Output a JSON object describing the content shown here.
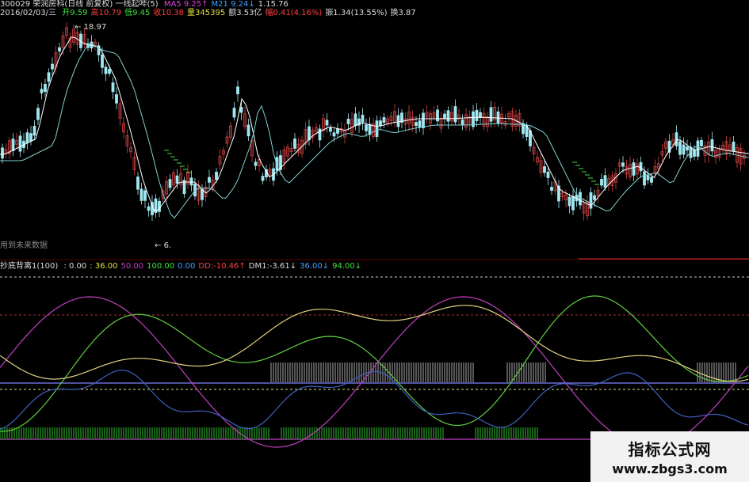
{
  "header": {
    "code_line": "300029 荣润房科(日线 前复权) 一线起哔(5)",
    "ma_items": [
      {
        "text": "MA5 9.25↑",
        "color": "#e040e0"
      },
      {
        "text": "M21 9.24↓",
        "color": "#40a0ff"
      },
      {
        "text": "1.15.76",
        "color": "#dddddd"
      }
    ],
    "date": "2016/02/03/三",
    "quote": [
      {
        "label": "开",
        "value": "9.59",
        "color": "#40e040"
      },
      {
        "label": "高",
        "value": "10.79",
        "color": "#ff4040"
      },
      {
        "label": "低",
        "value": "9.45",
        "color": "#40e040"
      },
      {
        "label": "收",
        "value": "10.38",
        "color": "#ff4040"
      },
      {
        "label": "量",
        "value": "345395",
        "color": "#e0e040"
      },
      {
        "label": "额",
        "value": "3.53亿",
        "color": "#dddddd"
      },
      {
        "label": "幅",
        "value": "0.41(4.16%)",
        "color": "#ff4040"
      },
      {
        "label": "振",
        "value": "1.34(13.55%)",
        "color": "#dddddd"
      },
      {
        "label": "换",
        "value": "3.87",
        "color": "#dddddd"
      }
    ]
  },
  "price_panel": {
    "high_marker": "18.97",
    "low_marker": "6.",
    "note": "用到未来数据"
  },
  "indicator_header": {
    "name": "抄底背离1(100)",
    "items": [
      {
        "text": ": 0.00",
        "color": "#dddddd"
      },
      {
        "text": ": 36.00",
        "color": "#e0e040"
      },
      {
        "text": "50.00",
        "color": "#c040c0"
      },
      {
        "text": "100.00",
        "color": "#40e040"
      },
      {
        "text": "0.00",
        "color": "#40a0ff"
      },
      {
        "text": "DD:-10.46↑",
        "color": "#ff4040"
      },
      {
        "text": "DM1:-3.61↓",
        "color": "#dddddd"
      },
      {
        "text": "36.00↓",
        "color": "#40a0ff"
      },
      {
        "text": "94.00↓",
        "color": "#40e040"
      }
    ]
  },
  "watermark": {
    "title": "指标公式网",
    "url": "www.zbgs3.com"
  },
  "colors": {
    "up": "#d04040",
    "down": "#a0e8f0",
    "ma_fast": "#ffffff",
    "ma_slow": "#80d0d0",
    "signal": "#40e040",
    "line_green": "#60d040",
    "line_magenta": "#c040c0",
    "line_yellow": "#e0d080",
    "line_blue": "#4060c0",
    "hline": "#8080ff"
  }
}
